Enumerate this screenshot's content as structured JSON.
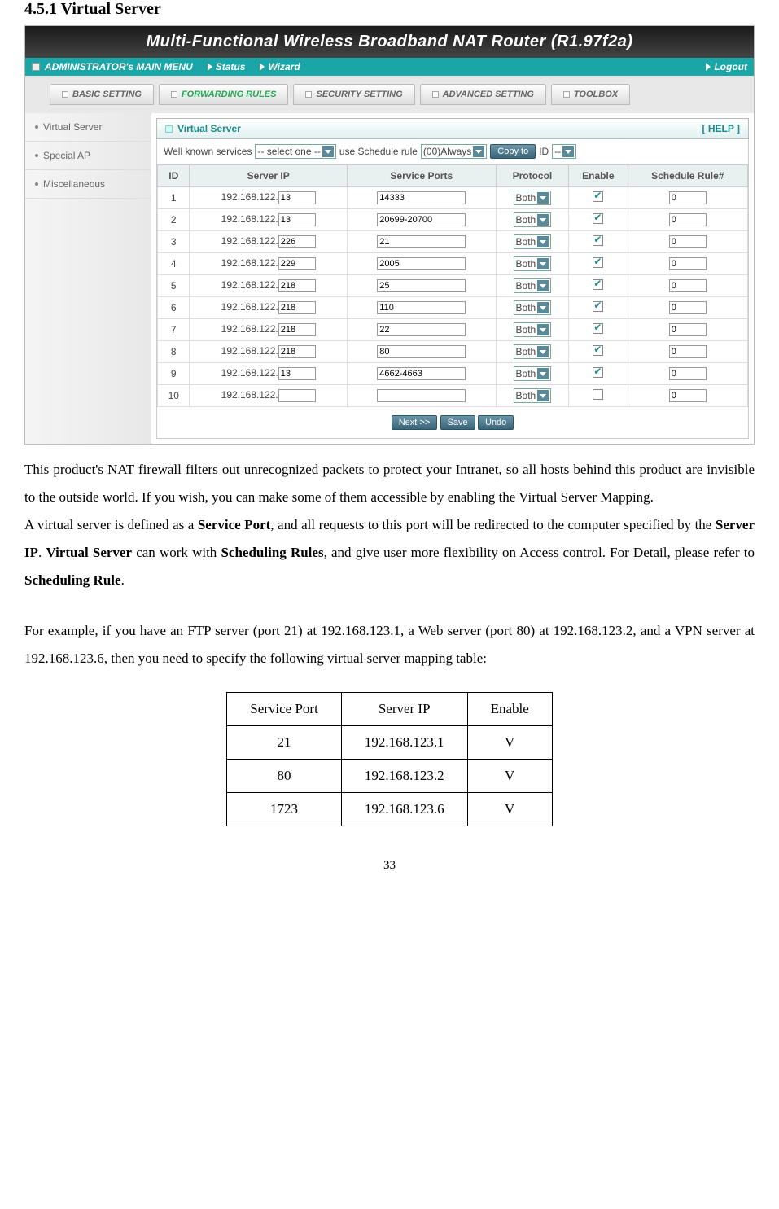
{
  "section_heading": "4.5.1 Virtual Server",
  "router": {
    "title": "Multi-Functional Wireless Broadband NAT Router (R1.97f2a)",
    "menubar": {
      "main": "ADMINISTRATOR's MAIN MENU",
      "status": "Status",
      "wizard": "Wizard",
      "logout": "Logout"
    },
    "tabs": [
      {
        "label": "BASIC SETTING"
      },
      {
        "label": "FORWARDING RULES"
      },
      {
        "label": "SECURITY SETTING"
      },
      {
        "label": "ADVANCED SETTING"
      },
      {
        "label": "TOOLBOX"
      }
    ],
    "sidebar": [
      "Virtual Server",
      "Special AP",
      "Miscellaneous"
    ],
    "panel": {
      "title": "Virtual Server",
      "help": "[ HELP ]",
      "svc": {
        "well_known_label": "Well known services",
        "well_known_value": "-- select one --",
        "sched_label": "use Schedule rule",
        "sched_value": "(00)Always",
        "copy_btn": "Copy to",
        "id_label": "ID",
        "id_value": "--"
      },
      "headers": {
        "id": "ID",
        "server_ip": "Server IP",
        "service_ports": "Service Ports",
        "protocol": "Protocol",
        "enable": "Enable",
        "schedule": "Schedule Rule#"
      },
      "ip_prefix": "192.168.122.",
      "proto_default": "Both",
      "rows": [
        {
          "id": "1",
          "ip_suffix": "13",
          "ports": "14333",
          "enabled": true,
          "sched": "0"
        },
        {
          "id": "2",
          "ip_suffix": "13",
          "ports": "20699-20700",
          "enabled": true,
          "sched": "0"
        },
        {
          "id": "3",
          "ip_suffix": "226",
          "ports": "21",
          "enabled": true,
          "sched": "0"
        },
        {
          "id": "4",
          "ip_suffix": "229",
          "ports": "2005",
          "enabled": true,
          "sched": "0"
        },
        {
          "id": "5",
          "ip_suffix": "218",
          "ports": "25",
          "enabled": true,
          "sched": "0"
        },
        {
          "id": "6",
          "ip_suffix": "218",
          "ports": "110",
          "enabled": true,
          "sched": "0"
        },
        {
          "id": "7",
          "ip_suffix": "218",
          "ports": "22",
          "enabled": true,
          "sched": "0"
        },
        {
          "id": "8",
          "ip_suffix": "218",
          "ports": "80",
          "enabled": true,
          "sched": "0"
        },
        {
          "id": "9",
          "ip_suffix": "13",
          "ports": "4662-4663",
          "enabled": true,
          "sched": "0"
        },
        {
          "id": "10",
          "ip_suffix": "",
          "ports": "",
          "enabled": false,
          "sched": "0"
        }
      ],
      "buttons": {
        "next": "Next >>",
        "save": "Save",
        "undo": "Undo"
      }
    }
  },
  "prose": {
    "p1": "This product's NAT firewall filters out unrecognized packets to protect your Intranet, so all hosts behind this product are invisible to the outside world. If you wish, you can make some of them accessible by enabling the Virtual Server Mapping.",
    "p2a": "A virtual server is defined as a ",
    "p2b": "Service Port",
    "p2c": ", and all requests to this port will be redirected to the computer specified by the ",
    "p2d": "Server IP",
    "p2e": ".   ",
    "p2f": "Virtual Server",
    "p2g": " can work with ",
    "p2h": "Scheduling Rules",
    "p2i": ", and give user more flexibility on Access control. For Detail, please refer to ",
    "p2j": "Scheduling Rule",
    "p2k": ".",
    "p3": "For example, if you have an FTP server (port 21) at 192.168.123.1, a Web server (port 80) at 192.168.123.2, and a VPN server at 192.168.123.6, then you need to specify the following virtual server mapping table:"
  },
  "example": {
    "headers": {
      "port": "Service Port",
      "ip": "Server IP",
      "enable": "Enable"
    },
    "rows": [
      {
        "port": "21",
        "ip": "192.168.123.1",
        "enable": "V"
      },
      {
        "port": "80",
        "ip": "192.168.123.2",
        "enable": "V"
      },
      {
        "port": "1723",
        "ip": "192.168.123.6",
        "enable": "V"
      }
    ]
  },
  "page_number": "33"
}
